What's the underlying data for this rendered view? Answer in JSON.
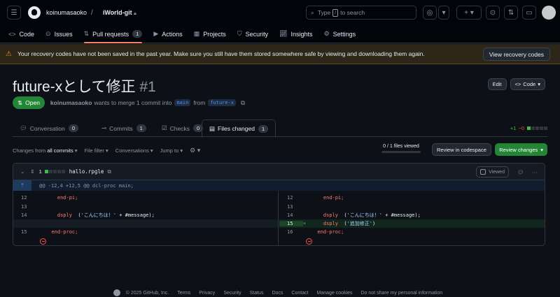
{
  "header": {
    "owner": "koinumasaoko",
    "repo": "iWorld-git",
    "search_placeholder": "Type",
    "search_key": "/",
    "search_suffix": "to search"
  },
  "repo_nav": [
    {
      "label": "Code",
      "icon": "code-icon"
    },
    {
      "label": "Issues",
      "icon": "issue-icon"
    },
    {
      "label": "Pull requests",
      "icon": "pull-request-icon",
      "count": "1",
      "active": true
    },
    {
      "label": "Actions",
      "icon": "play-icon"
    },
    {
      "label": "Projects",
      "icon": "table-icon"
    },
    {
      "label": "Security",
      "icon": "shield-icon"
    },
    {
      "label": "Insights",
      "icon": "graph-icon"
    },
    {
      "label": "Settings",
      "icon": "gear-icon"
    }
  ],
  "banner": {
    "text": "Your recovery codes have not been saved in the past year. Make sure you still have them stored somewhere safe by viewing and downloading them again.",
    "button": "View recovery codes"
  },
  "pr": {
    "title": "future-xとして修正",
    "number": "#1",
    "status": "Open",
    "author": "koinumasaoko",
    "merge_text": "wants to merge 1 commit into",
    "base": "main",
    "from": "from",
    "head": "future-x",
    "edit": "Edit",
    "code": "Code"
  },
  "tabs": [
    {
      "label": "Conversation",
      "count": "0"
    },
    {
      "label": "Commits",
      "count": "1"
    },
    {
      "label": "Checks",
      "count": "0"
    },
    {
      "label": "Files changed",
      "count": "1",
      "active": true
    }
  ],
  "diffstat": {
    "additions": "+1",
    "deletions": "−0"
  },
  "toolbar": {
    "changes_from": "Changes from",
    "all_commits": "all commits",
    "file_filter": "File filter",
    "conversations": "Conversations",
    "jump_to": "Jump to",
    "viewed_count": "0 / 1 files viewed",
    "codespace": "Review in codespace",
    "review": "Review changes"
  },
  "file": {
    "changes": "1",
    "name": "hallo.rpgle",
    "viewed_label": "Viewed",
    "hunk": "@@ -12,4 +12,5 @@ dcl-proc main;",
    "left": [
      {
        "ln": "12",
        "code": "    end-pi;"
      },
      {
        "ln": "13",
        "code": ""
      },
      {
        "ln": "14",
        "code": "    dsply  ('こんにちは！' + #message);"
      },
      {
        "ln": "",
        "code": ""
      },
      {
        "ln": "15",
        "code": "  end-proc;"
      }
    ],
    "right": [
      {
        "ln": "12",
        "code": "    end-pi;"
      },
      {
        "ln": "13",
        "code": ""
      },
      {
        "ln": "14",
        "code": "    dsply  ('こんにちは！' + #message);"
      },
      {
        "ln": "15",
        "code": "    dsply  ('追加修正')",
        "sign": "+"
      },
      {
        "ln": "16",
        "code": "  end-proc;"
      }
    ]
  },
  "footer": [
    "© 2025 GitHub, Inc.",
    "Terms",
    "Privacy",
    "Security",
    "Status",
    "Docs",
    "Contact",
    "Manage cookies",
    "Do not share my personal information"
  ]
}
